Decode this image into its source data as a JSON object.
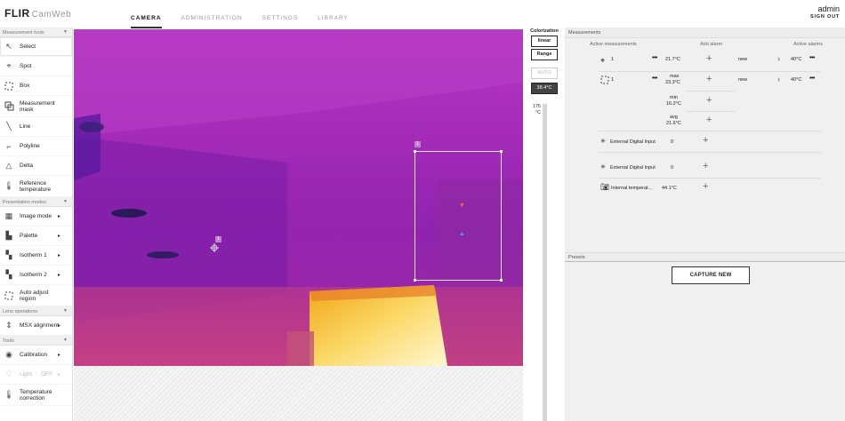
{
  "app": {
    "brand": "FLIR",
    "product": "CamWeb"
  },
  "nav": {
    "tabs": [
      "CAMERA",
      "ADMINISTRATION",
      "SETTINGS",
      "LIBRARY"
    ],
    "active": "CAMERA"
  },
  "user": {
    "name": "admin",
    "signout": "SIGN OUT"
  },
  "sidebar": {
    "measurement_tools": {
      "title": "Measurement tools",
      "items": [
        "Select",
        "Spot",
        "Box",
        "Measurement mask",
        "Line",
        "Polyline",
        "Delta",
        "Reference temperature"
      ]
    },
    "presentation_modes": {
      "title": "Presentation modes",
      "items": [
        "Image mode",
        "Palette",
        "Isotherm 1",
        "Isotherm 2",
        "Auto adjust region"
      ]
    },
    "lens_operations": {
      "title": "Lens operations",
      "items": [
        "MSX alignment"
      ]
    },
    "tools": {
      "title": "Tools",
      "items": [
        "Calibration",
        "Light",
        "Temperature correction"
      ],
      "light_state": "OFF"
    }
  },
  "overlay": {
    "spot_label": "1",
    "box_label": "1"
  },
  "colorization": {
    "title": "Colorization",
    "mode1": "linear",
    "mode2": "Range",
    "auto": "AUTO",
    "current_temp": "38.4°C",
    "scale_top": "175",
    "scale_unit": "°C"
  },
  "measurements": {
    "title": "Measurements",
    "col_active": "Active measurements",
    "col_add_alarm": "Add alarm",
    "col_active_alarms": "Active alarms",
    "spot": {
      "id": "1",
      "value": "21.7°C",
      "alarm_state": "new",
      "alarm_value": "40°C"
    },
    "box": {
      "id": "1",
      "max_label": "max",
      "max_value": "23.3°C",
      "min_label": "min",
      "min_value": "16.2°C",
      "avg_label": "avg",
      "avg_value": "21.6°C",
      "alarm_state": "new",
      "alarm_value": "40°C"
    },
    "ext1": {
      "label": "External Digital Input",
      "value": "0"
    },
    "ext2": {
      "label": "External Digital Input",
      "value": "0"
    },
    "internal": {
      "label": "Internal temperat...",
      "value": "44.1°C"
    }
  },
  "presets": {
    "title": "Presets",
    "capture_label": "CAPTURE NEW"
  }
}
